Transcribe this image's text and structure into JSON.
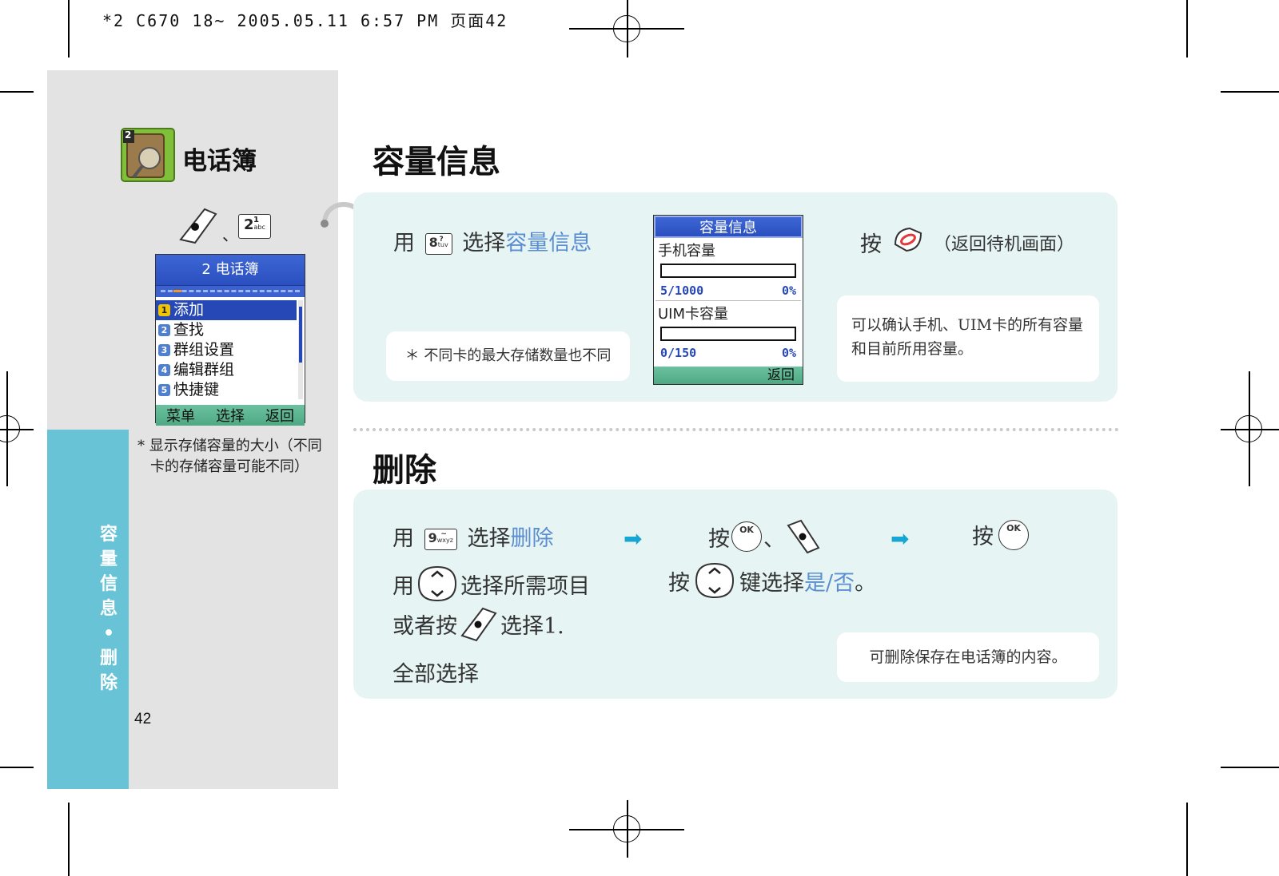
{
  "header": {
    "print_line": "*2 C670 18~ 2005.05.11 6:57 PM 页面42"
  },
  "sidebar": {
    "chapter_badge": "2",
    "chapter_title": "电话簿",
    "key_sep": "、",
    "key_2": {
      "num": "2",
      "sub": "abc",
      "sup": "1"
    },
    "phone": {
      "title": "2 电话簿",
      "items": [
        {
          "num": "1",
          "label": "添加"
        },
        {
          "num": "2",
          "label": "查找"
        },
        {
          "num": "3",
          "label": "群组设置"
        },
        {
          "num": "4",
          "label": "编辑群组"
        },
        {
          "num": "5",
          "label": "快捷键"
        }
      ],
      "soft_left": "菜单",
      "soft_mid": "选择",
      "soft_right": "返回"
    },
    "note_star": "*",
    "note_line1": "显示存储容量的大小（不同",
    "note_line2": "卡的存储容量可能不同）",
    "vertical_title": [
      "容",
      "量",
      "信",
      "息",
      "•",
      "删",
      "除"
    ],
    "page_number": "42"
  },
  "section1": {
    "title": "容量信息",
    "step_use": "用",
    "key_8": {
      "num": "8",
      "sub": "tuv",
      "sup": "?"
    },
    "step_select": "选择",
    "step_target": "容量信息",
    "note_left": "＊ 不同卡的最大存储数量也不同",
    "screen": {
      "title": "容量信息",
      "phone_label": "手机容量",
      "phone_usage": "5/1000",
      "phone_pct": "0%",
      "phone_fill": 0.0,
      "uim_label": "UIM卡容量",
      "uim_usage": "0/150",
      "uim_pct": "0%",
      "uim_fill": 0.0,
      "soft_right": "返回"
    },
    "press": "按",
    "press_note": "（返回待机画面）",
    "note_right_line1": "可以确认手机、UIM卡的所有容量",
    "note_right_line2": "和目前所用容量。"
  },
  "section2": {
    "title": "删除",
    "step1_use": "用",
    "key_9": {
      "num": "9",
      "sub": "wxyz",
      "sup": "~"
    },
    "step1_select": "选择",
    "step1_target": "删除",
    "step2_use": "用",
    "step2_text": "选择所需项目",
    "step3_pre": "或者按",
    "step3_post": "选择1.",
    "step4": "全部选择",
    "mid_press": "按",
    "mid_sep": "、",
    "mid2_press": "按",
    "mid2_text": "键选择",
    "mid2_target": "是/否",
    "mid2_end": "。",
    "right_press": "按",
    "ok_label": "OK",
    "note_right": "可删除保存在电话簿的内容。",
    "arrow_glyph": "➡"
  },
  "colors": {
    "accent_blue": "#5b8ed0",
    "sidebar_blue": "#67c3d5",
    "panel_bg": "#e6f4f4",
    "arrow": "#17a6d3"
  }
}
